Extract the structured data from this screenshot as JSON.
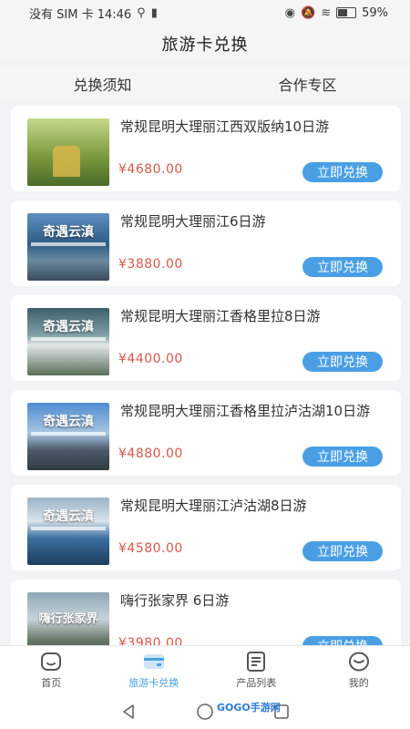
{
  "status_bar": {
    "carrier_time": "没有 SIM 卡 14:46",
    "battery": "59%"
  },
  "header": {
    "title": "旅游卡兑换"
  },
  "tabs": [
    {
      "label": "兑换须知"
    },
    {
      "label": "合作专区"
    }
  ],
  "products": [
    {
      "name": "常规昆明大理丽江西双版纳10日游",
      "price": "¥4680.00",
      "button": "立即兑换",
      "thumb_text": "",
      "thumb_color": "#8aa34a"
    },
    {
      "name": "常规昆明大理丽江6日游",
      "price": "¥3880.00",
      "button": "立即兑换",
      "thumb_text": "奇遇云滇",
      "thumb_color": "#3c6f9a"
    },
    {
      "name": "常规昆明大理丽江香格里拉8日游",
      "price": "¥4400.00",
      "button": "立即兑换",
      "thumb_text": "奇遇云滇",
      "thumb_color": "#4d7f8a"
    },
    {
      "name": "常规昆明大理丽江香格里拉泸沽湖10日游",
      "price": "¥4880.00",
      "button": "立即兑换",
      "thumb_text": "奇遇云滇",
      "thumb_color": "#4a83b8"
    },
    {
      "name": "常规昆明大理丽江泸沽湖8日游",
      "price": "¥4580.00",
      "button": "立即兑换",
      "thumb_text": "奇遇云滇",
      "thumb_color": "#3f70a4"
    },
    {
      "name": "嗨行张家界 6日游",
      "price": "¥3980.00",
      "button": "立即兑换",
      "thumb_text": "嗨行张家界",
      "thumb_color": "#5d6f7a"
    }
  ],
  "bottom_nav": [
    {
      "label": "首页",
      "icon": "home-icon"
    },
    {
      "label": "旅游卡兑换",
      "icon": "card-icon"
    },
    {
      "label": "产品列表",
      "icon": "list-icon"
    },
    {
      "label": "我的",
      "icon": "profile-icon"
    }
  ],
  "watermark": "GOGO手游网",
  "colors": {
    "accent": "#4a9fe4",
    "price": "#d8584b"
  }
}
